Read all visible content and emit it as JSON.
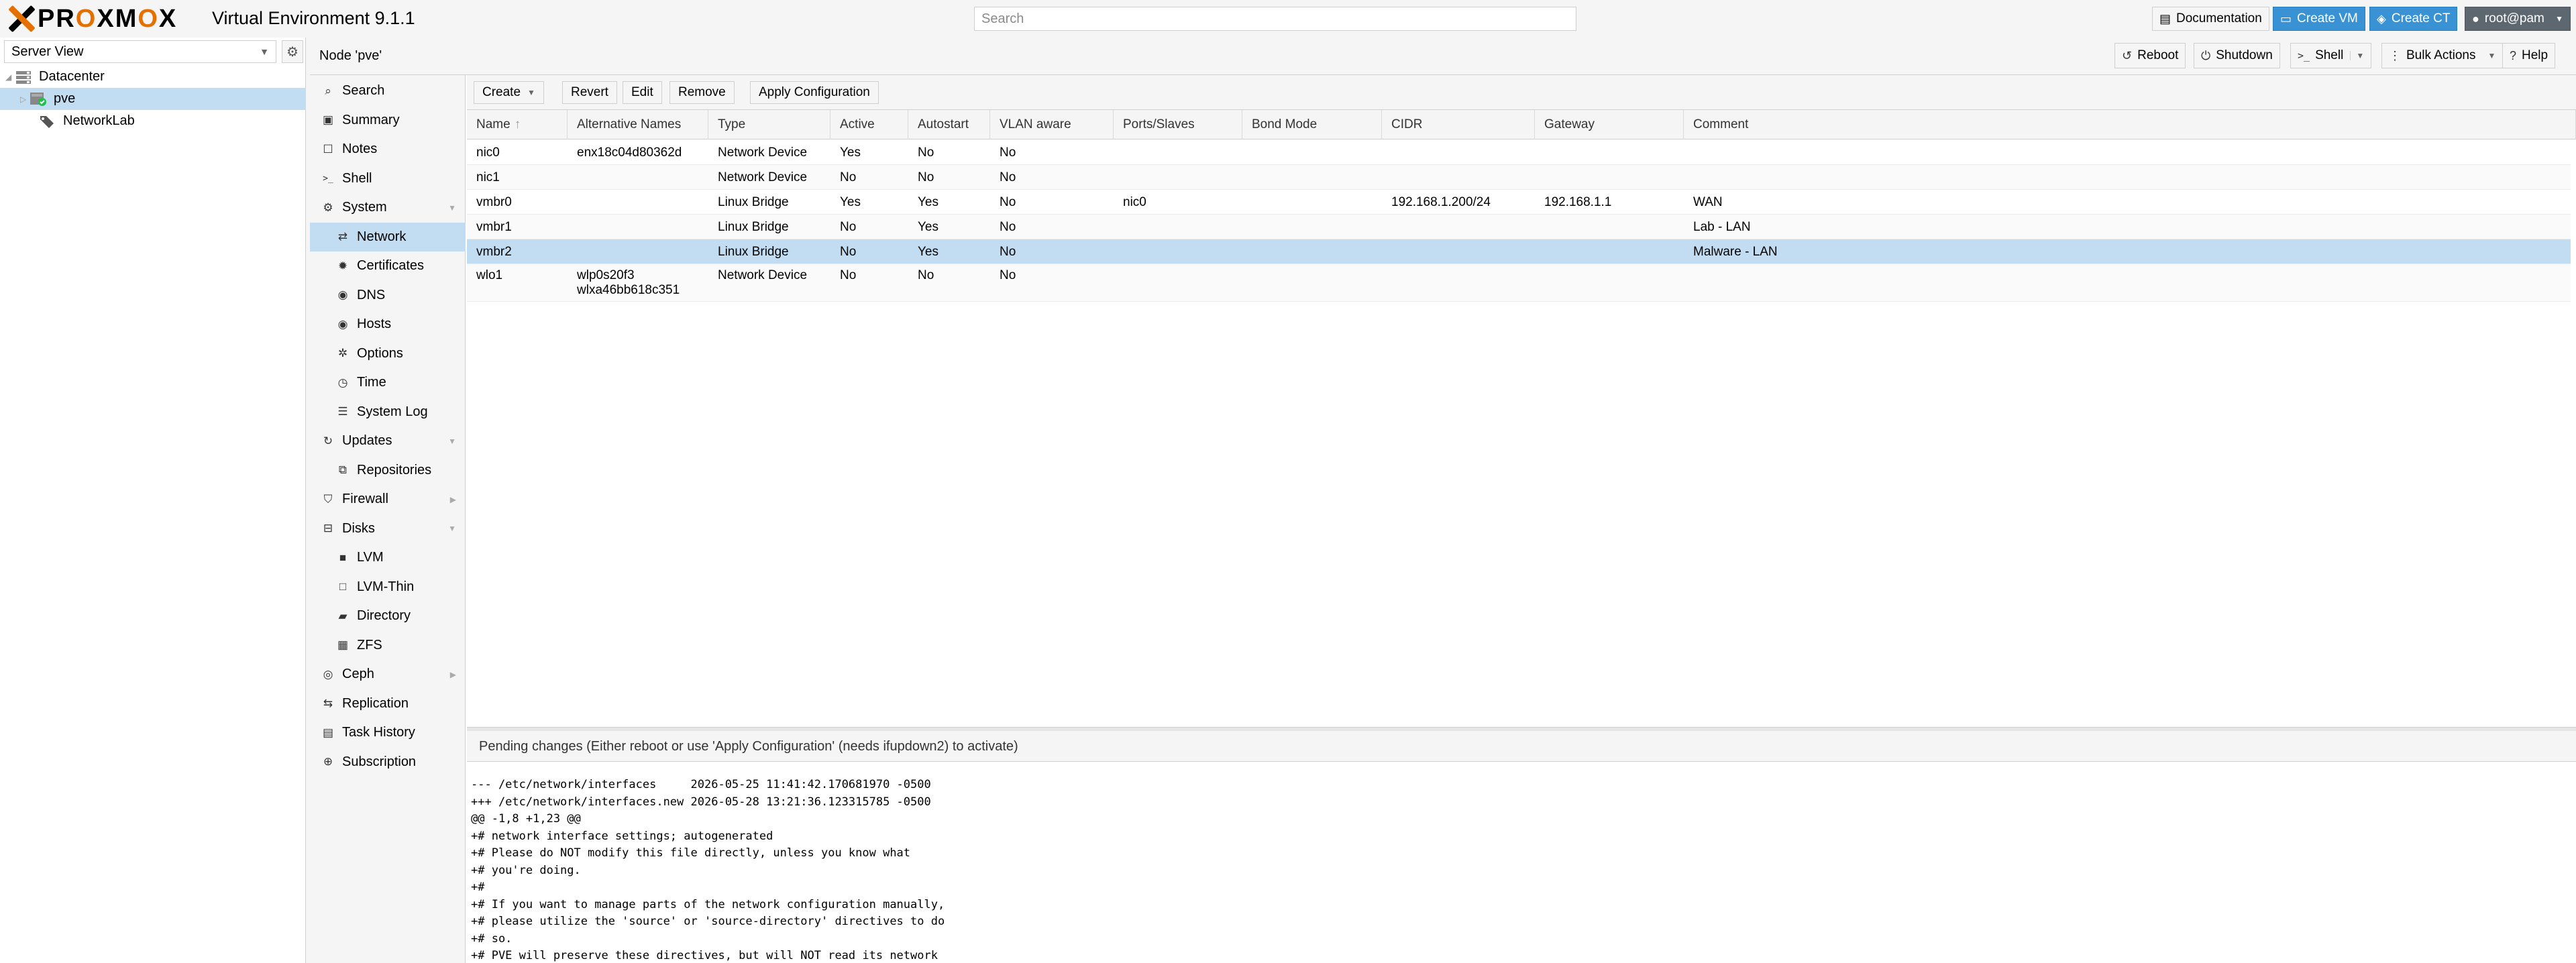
{
  "app": {
    "logo_text": "PROXMOX",
    "product": "Virtual Environment 9.1.1",
    "search_placeholder": "Search",
    "buttons": {
      "documentation": "Documentation",
      "create_vm": "Create VM",
      "create_ct": "Create CT",
      "user": "root@pam"
    }
  },
  "tree": {
    "view": "Server View",
    "items": [
      {
        "label": "Datacenter",
        "icon": "datacenter-icon"
      },
      {
        "label": "pve",
        "icon": "node-online-icon",
        "selected": true
      },
      {
        "label": "NetworkLab",
        "icon": "tags-icon"
      }
    ]
  },
  "node": {
    "title": "Node 'pve'",
    "actions": {
      "reboot": "Reboot",
      "shutdown": "Shutdown",
      "shell": "Shell",
      "bulk": "Bulk Actions",
      "help": "Help"
    }
  },
  "nav": [
    {
      "label": "Search",
      "icon": "search-icon"
    },
    {
      "label": "Summary",
      "icon": "summary-icon"
    },
    {
      "label": "Notes",
      "icon": "notes-icon"
    },
    {
      "label": "Shell",
      "icon": "terminal-icon"
    },
    {
      "label": "System",
      "icon": "cogs-icon",
      "expandable": true
    },
    {
      "label": "Network",
      "icon": "network-icon",
      "sub": true,
      "selected": true
    },
    {
      "label": "Certificates",
      "icon": "certificate-icon",
      "sub": true
    },
    {
      "label": "DNS",
      "icon": "globe-icon",
      "sub": true
    },
    {
      "label": "Hosts",
      "icon": "globe-icon",
      "sub": true
    },
    {
      "label": "Options",
      "icon": "gear-icon",
      "sub": true
    },
    {
      "label": "Time",
      "icon": "clock-icon",
      "sub": true
    },
    {
      "label": "System Log",
      "icon": "list-icon",
      "sub": true
    },
    {
      "label": "Updates",
      "icon": "refresh-icon",
      "expandable": true
    },
    {
      "label": "Repositories",
      "icon": "repository-icon",
      "sub": true
    },
    {
      "label": "Firewall",
      "icon": "shield-icon",
      "collapsed": true
    },
    {
      "label": "Disks",
      "icon": "hdd-icon",
      "expandable": true
    },
    {
      "label": "LVM",
      "icon": "square-icon",
      "sub": true
    },
    {
      "label": "LVM-Thin",
      "icon": "square-outline-icon",
      "sub": true
    },
    {
      "label": "Directory",
      "icon": "folder-icon",
      "sub": true
    },
    {
      "label": "ZFS",
      "icon": "th-large-icon",
      "sub": true
    },
    {
      "label": "Ceph",
      "icon": "ceph-icon",
      "collapsed": true
    },
    {
      "label": "Replication",
      "icon": "retweet-icon"
    },
    {
      "label": "Task History",
      "icon": "list-alt-icon"
    },
    {
      "label": "Subscription",
      "icon": "support-icon"
    }
  ],
  "network": {
    "toolbar": {
      "create": "Create",
      "revert": "Revert",
      "edit": "Edit",
      "remove": "Remove",
      "apply": "Apply Configuration"
    },
    "columns": [
      "Name",
      "Alternative Names",
      "Type",
      "Active",
      "Autostart",
      "VLAN aware",
      "Ports/Slaves",
      "Bond Mode",
      "CIDR",
      "Gateway",
      "Comment"
    ],
    "sort_indicator": "↑",
    "rows": [
      {
        "name": "nic0",
        "alt": [
          "enx18c04d80362d"
        ],
        "type": "Network Device",
        "active": "Yes",
        "autostart": "No",
        "vlan": "No",
        "ports": "",
        "bond": "",
        "cidr": "",
        "gateway": "",
        "comment": ""
      },
      {
        "name": "nic1",
        "alt": [],
        "type": "Network Device",
        "active": "No",
        "autostart": "No",
        "vlan": "No",
        "ports": "",
        "bond": "",
        "cidr": "",
        "gateway": "",
        "comment": ""
      },
      {
        "name": "vmbr0",
        "alt": [],
        "type": "Linux Bridge",
        "active": "Yes",
        "autostart": "Yes",
        "vlan": "No",
        "ports": "nic0",
        "bond": "",
        "cidr": "192.168.1.200/24",
        "gateway": "192.168.1.1",
        "comment": "WAN"
      },
      {
        "name": "vmbr1",
        "alt": [],
        "type": "Linux Bridge",
        "active": "No",
        "autostart": "Yes",
        "vlan": "No",
        "ports": "",
        "bond": "",
        "cidr": "",
        "gateway": "",
        "comment": "Lab - LAN"
      },
      {
        "name": "vmbr2",
        "alt": [],
        "type": "Linux Bridge",
        "active": "No",
        "autostart": "Yes",
        "vlan": "No",
        "ports": "",
        "bond": "",
        "cidr": "",
        "gateway": "",
        "comment": "Malware - LAN",
        "selected": true
      },
      {
        "name": "wlo1",
        "alt": [
          "wlp0s20f3",
          "wlxa46bb618c351"
        ],
        "type": "Network Device",
        "active": "No",
        "autostart": "No",
        "vlan": "No",
        "ports": "",
        "bond": "",
        "cidr": "",
        "gateway": "",
        "comment": ""
      }
    ]
  },
  "pending": {
    "title": "Pending changes (Either reboot or use 'Apply Configuration' (needs ifupdown2) to activate)",
    "diff": [
      "--- /etc/network/interfaces     2026-05-25 11:41:42.170681970 -0500",
      "+++ /etc/network/interfaces.new 2026-05-28 13:21:36.123315785 -0500",
      "@@ -1,8 +1,23 @@",
      "+# network interface settings; autogenerated",
      "+# Please do NOT modify this file directly, unless you know what",
      "+# you're doing.",
      "+#",
      "+# If you want to manage parts of the network configuration manually,",
      "+# please utilize the 'source' or 'source-directory' directives to do",
      "+# so.",
      "+# PVE will preserve these directives, but will NOT read its network"
    ]
  },
  "colors": {
    "accent": "#3892d4",
    "selection": "#c2ddf2",
    "brand_orange": "#e57000",
    "online": "#21bf4b"
  }
}
